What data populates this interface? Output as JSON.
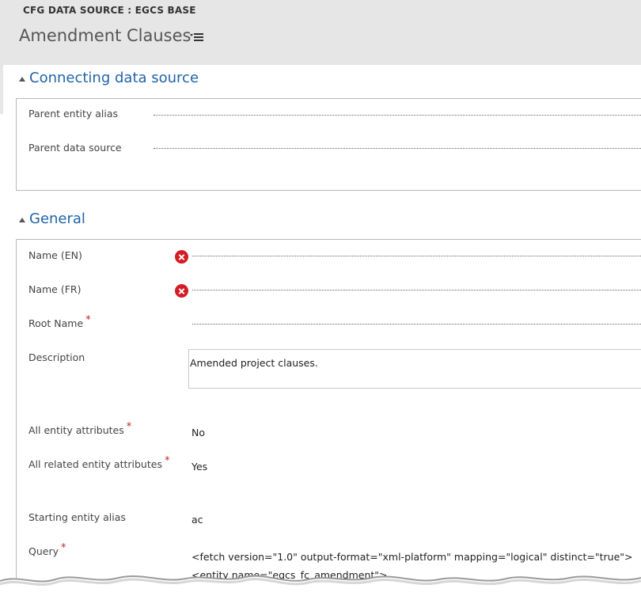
{
  "header": {
    "entity_type": "CFG DATA SOURCE : EGCS BASE",
    "record_title": "Amendment Clauses",
    "menu_icon": "menu-icon"
  },
  "sections": {
    "connecting": {
      "title": "Connecting data source",
      "fields": {
        "parent_alias": {
          "label": "Parent entity alias",
          "value": ""
        },
        "parent_source": {
          "label": "Parent data source",
          "value": ""
        }
      }
    },
    "general": {
      "title": "General",
      "fields": {
        "name_en": {
          "label": "Name (EN)",
          "value": "",
          "status_icon": "error-icon"
        },
        "name_fr": {
          "label": "Name (FR)",
          "value": "",
          "status_icon": "error-icon"
        },
        "root_name": {
          "label": "Root Name",
          "required_marker": "*",
          "value": ""
        },
        "description": {
          "label": "Description",
          "value": "Amended project clauses."
        },
        "all_entity_attributes": {
          "label": "All entity attributes",
          "required_marker": "*",
          "value": "No"
        },
        "all_related_entity_attributes": {
          "label": "All related entity attributes",
          "required_marker": "*",
          "value": "Yes"
        },
        "starting_entity_alias": {
          "label": "Starting entity alias",
          "value": "ac"
        },
        "query": {
          "label": "Query",
          "required_marker": "*",
          "line1": "<fetch version=\"1.0\" output-format=\"xml-platform\" mapping=\"logical\" distinct=\"true\">",
          "line2": "<entity name=\"egcs_fc_amendment\">"
        }
      }
    }
  },
  "colors": {
    "header_bg": "#e6e6e6",
    "section_title": "#1f64a8",
    "required": "#c0272d",
    "error": "#d41c24"
  }
}
